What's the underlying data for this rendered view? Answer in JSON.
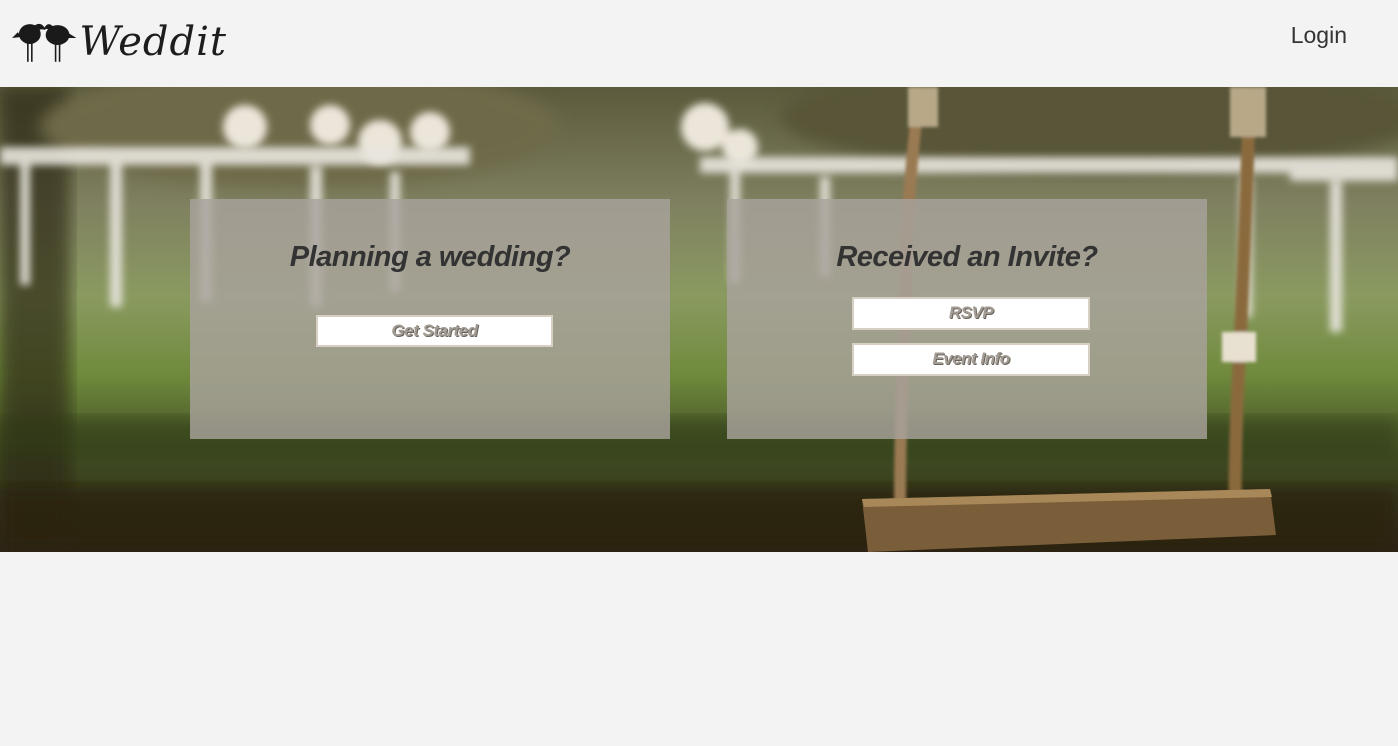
{
  "navbar": {
    "logo_text": "Weddit",
    "login_label": "Login"
  },
  "hero": {
    "image": "wedding-swing-lawn-photo",
    "plan_card": {
      "title": "Planning a wedding?",
      "get_started_label": "Get Started"
    },
    "invite_card": {
      "title": "Received an Invite?",
      "rsvp_label": "RSVP",
      "event_info_label": "Event Info"
    }
  }
}
